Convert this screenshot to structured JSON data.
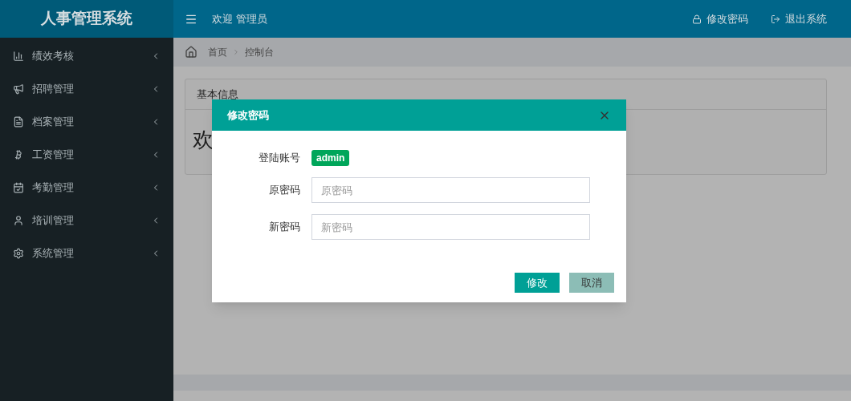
{
  "header": {
    "logo": "人事管理系统",
    "welcome": "欢迎 管理员",
    "actions": [
      {
        "kind": "password",
        "label": "修改密码"
      },
      {
        "kind": "logout",
        "label": "退出系统"
      }
    ]
  },
  "sidebar": {
    "items": [
      {
        "kind": "chart",
        "label": "绩效考核",
        "expanded": false
      },
      {
        "kind": "megaphone",
        "label": "招聘管理",
        "expanded": false
      },
      {
        "kind": "file",
        "label": "档案管理",
        "expanded": false
      },
      {
        "kind": "bitcoin",
        "label": "工资管理",
        "expanded": false
      },
      {
        "kind": "calendar",
        "label": "考勤管理",
        "expanded": false
      },
      {
        "kind": "person",
        "label": "培训管理",
        "expanded": false
      },
      {
        "kind": "gear",
        "label": "系统管理",
        "expanded": false
      }
    ]
  },
  "breadcrumb": [
    "首页",
    "控制台"
  ],
  "card": {
    "title": "基本信息",
    "text": "欢"
  },
  "dialog": {
    "title": "修改密码",
    "account_label": "登陆账号",
    "account": "admin",
    "fields": [
      {
        "label": "原密码",
        "placeholder": "原密码"
      },
      {
        "label": "新密码",
        "placeholder": "新密码"
      }
    ],
    "buttons": [
      {
        "kind": "primary",
        "label": "修改"
      },
      {
        "kind": "secondary",
        "label": "取消"
      }
    ]
  }
}
